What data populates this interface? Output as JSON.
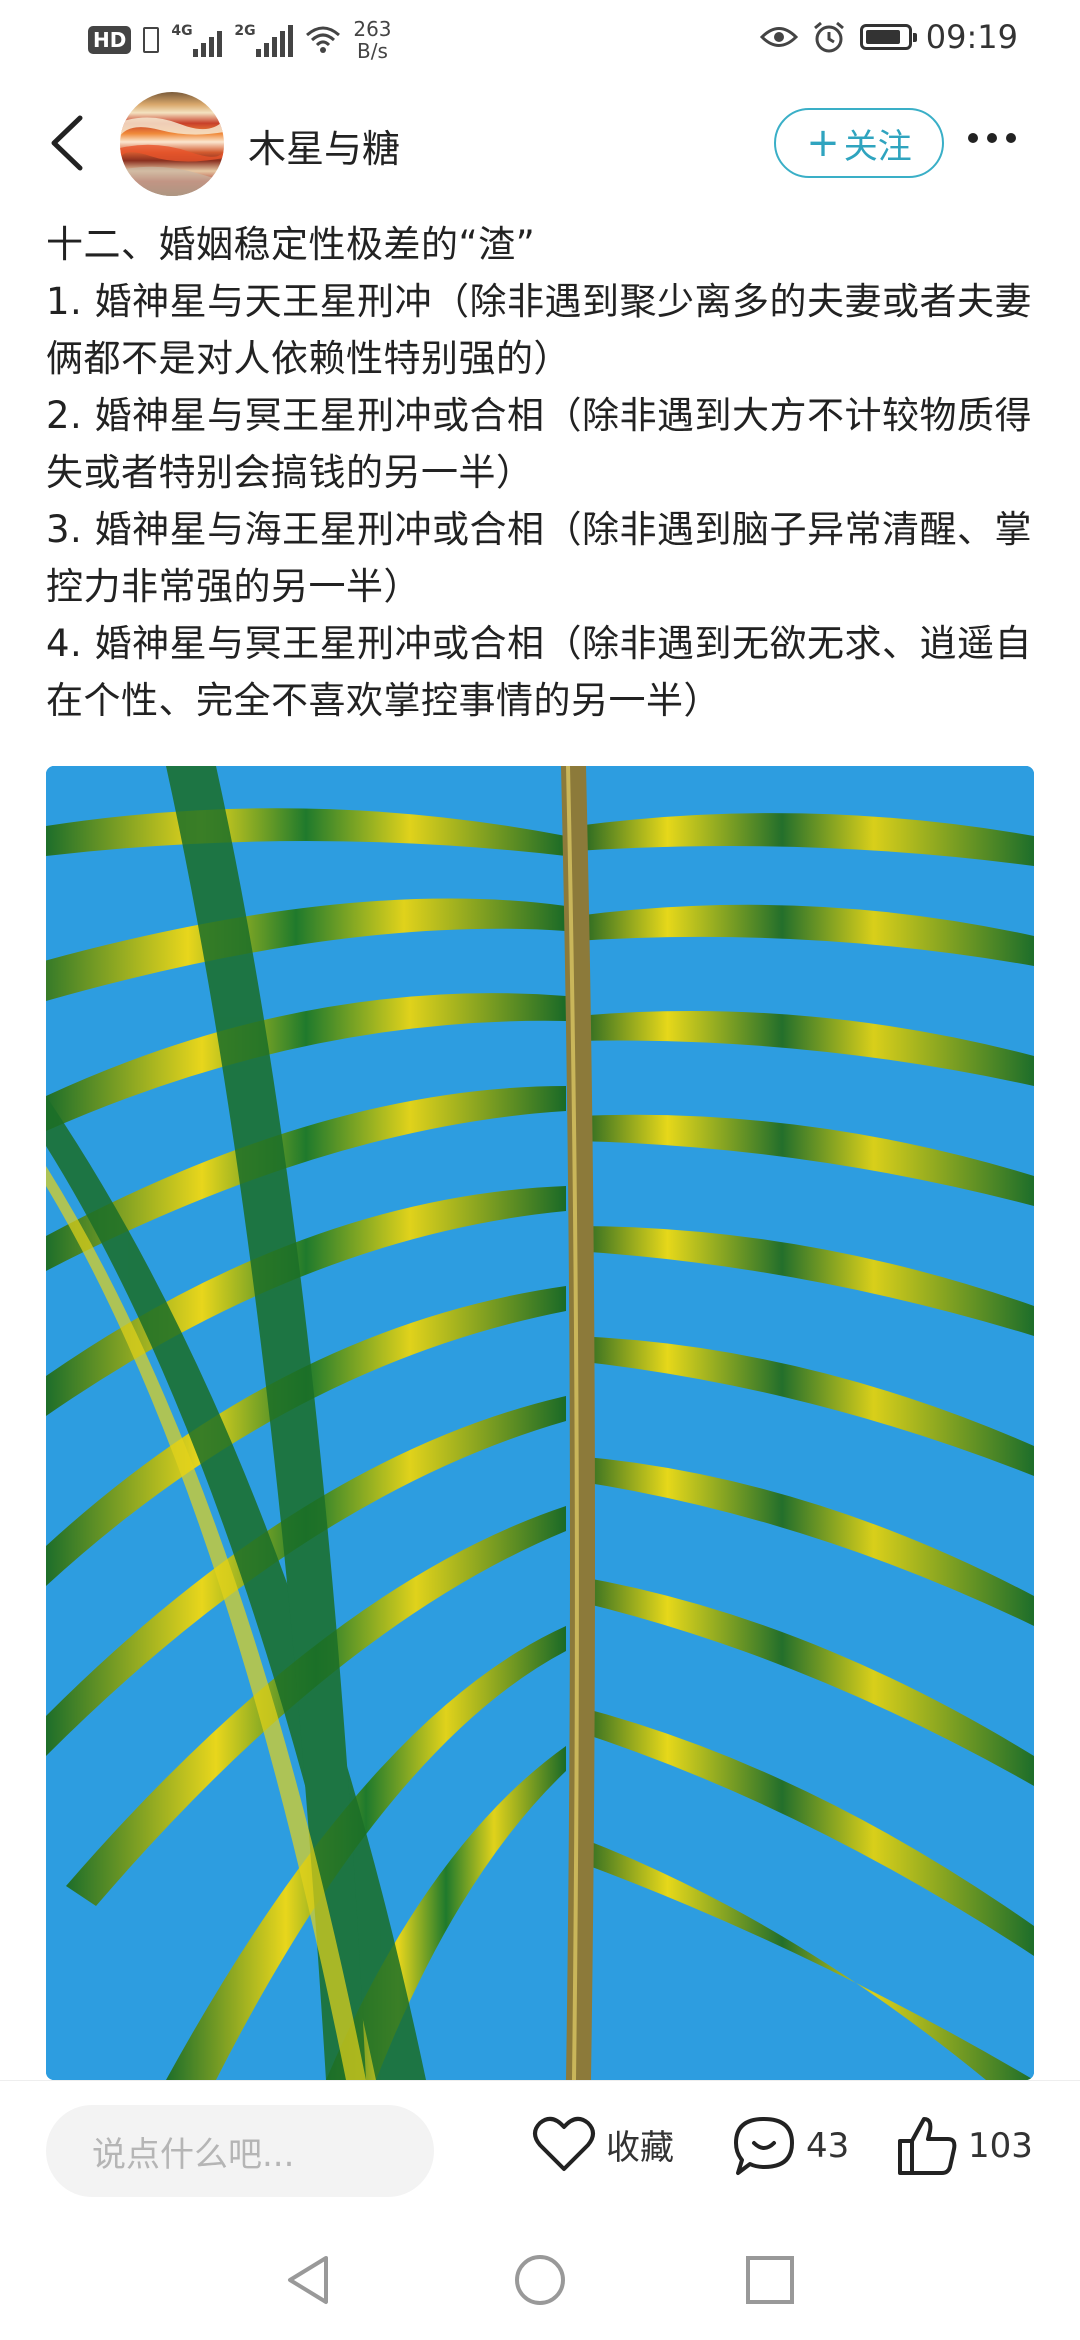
{
  "status_bar": {
    "network_speed_value": "263",
    "network_speed_unit": "B/s",
    "time": "09:19",
    "hd_badge": "HD",
    "sim1_gen": "4G",
    "sim2_gen": "2G"
  },
  "header": {
    "username": "木星与糖",
    "follow_label": "关注",
    "follow_plus": "+"
  },
  "article": {
    "lines": [
      "十二、婚姻稳定性极差的“渣”",
      "1. 婚神星与天王星刑冲（除非遇到聚少离多的夫妻或者夫妻俩都不是对人依赖性特别强的）",
      "2. 婚神星与冥王星刑冲或合相（除非遇到大方不计较物质得失或者特别会搞钱的另一半）",
      "3. 婚神星与海王星刑冲或合相（除非遇到脑子异常清醒、掌控力非常强的另一半）",
      "4. 婚神星与冥王星刑冲或合相（除非遇到无欲无求、逍遥自在个性、完全不喜欢掌控事情的另一半）"
    ]
  },
  "bottom_bar": {
    "comment_placeholder": "说点什么吧...",
    "favorite_label": "收藏",
    "comment_count": "43",
    "like_count": "103"
  },
  "colors": {
    "accent": "#2fa4bf",
    "sky": "#2d9de0",
    "leaf_dark": "#1f7a2c",
    "leaf_yellow": "#e6d81a"
  }
}
